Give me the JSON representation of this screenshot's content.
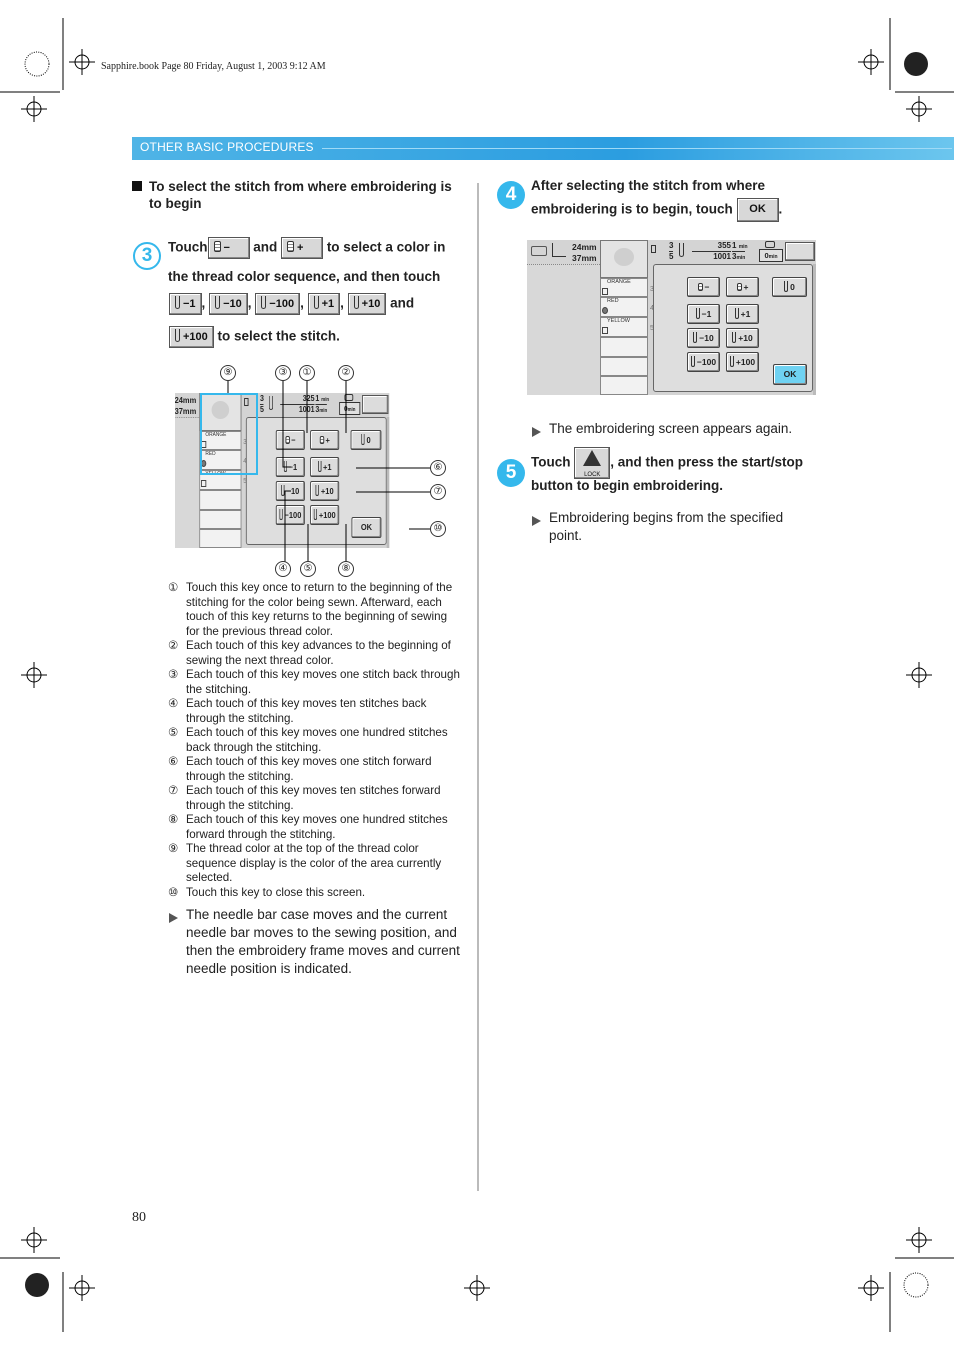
{
  "print_meta": "Sapphire.book  Page 80  Friday, August 1, 2003  9:12 AM",
  "section_header": "OTHER BASIC PROCEDURES",
  "page_number": "80",
  "left": {
    "heading": "To select the stitch from where embroidering is to begin",
    "step3": {
      "number": "3",
      "touch": "Touch",
      "and1": "and",
      "line1_end": "to select a color in",
      "line2": "the thread color sequence, and then touch",
      "and2": "and",
      "line4_end": "to select the stitch.",
      "buttons": [
        "−",
        "+",
        "−1",
        "−10",
        "−100",
        "+1",
        "+10",
        "+100"
      ],
      "comma": ","
    },
    "callouts": [
      "⑨",
      "③",
      "①",
      "②",
      "⑥",
      "⑦",
      "⑩",
      "④",
      "⑤",
      "⑧"
    ],
    "notes": [
      {
        "n": "①",
        "t": "Touch this key once to return to the beginning of the stitching for the color being sewn. Afterward, each touch of this key returns to the beginning of sewing for the previous thread color."
      },
      {
        "n": "②",
        "t": "Each touch of this key advances to the beginning of sewing the next thread color."
      },
      {
        "n": "③",
        "t": "Each touch of this key moves one stitch back through the stitching."
      },
      {
        "n": "④",
        "t": "Each touch of this key moves ten stitches back through the stitching."
      },
      {
        "n": "⑤",
        "t": "Each touch of this key moves one hundred stitches back through the stitching."
      },
      {
        "n": "⑥",
        "t": "Each touch of this key moves one stitch forward through the stitching."
      },
      {
        "n": "⑦",
        "t": "Each touch of this key moves ten stitches forward through the stitching."
      },
      {
        "n": "⑧",
        "t": "Each touch of this key moves one hundred stitches forward through the stitching."
      },
      {
        "n": "⑨",
        "t": "The thread color at the top of the thread color sequence display is the color of the area currently selected."
      },
      {
        "n": "⑩",
        "t": "Touch this key to close this screen."
      }
    ],
    "result": "The needle bar case moves and the current needle bar moves to the sewing position, and then the embroidery frame moves and current needle position is indicated."
  },
  "right": {
    "step4": {
      "number": "4",
      "line1": "After selecting the stitch from where",
      "line2": "embroidering is to begin, touch",
      "ok": "OK",
      "period": "."
    },
    "result4": "The embroidering screen appears again.",
    "step5": {
      "number": "5",
      "touch": "Touch",
      "lock": "LOCK",
      "line1_end": ", and then press the start/stop",
      "line2": "button to begin embroidering."
    },
    "result5": "Embroidering begins from the specified point."
  },
  "screens": {
    "left": {
      "width": "24mm",
      "height": "37mm",
      "colors": [
        "ORANGE",
        "RED",
        "YELLOW"
      ],
      "seq": [
        "3",
        "4",
        "5"
      ],
      "color_cur": "3",
      "color_total": "5",
      "stitch_cur": "325",
      "stitch_total": "1001",
      "time_cur": "1",
      "time_total": "3",
      "time_unit": "min",
      "time_left": "0",
      "buttons": [
        "−",
        "+",
        "0",
        "−1",
        "+1",
        "−10",
        "+10",
        "−100",
        "+100",
        "OK"
      ],
      "ok_color": "#dcdcdc"
    },
    "right": {
      "width": "24mm",
      "height": "37mm",
      "colors": [
        "ORANGE",
        "RED",
        "YELLOW"
      ],
      "seq": [
        "3",
        "4",
        "5"
      ],
      "color_cur": "3",
      "color_total": "5",
      "stitch_cur": "355",
      "stitch_total": "1001",
      "time_cur": "1",
      "time_total": "3",
      "time_unit": "min",
      "time_left": "0",
      "buttons": [
        "−",
        "+",
        "0",
        "−1",
        "+1",
        "−10",
        "+10",
        "−100",
        "+100",
        "OK"
      ],
      "ok_color": "#6fd2f2"
    }
  },
  "colors": {
    "accent": "#35b8ec",
    "header": "#2b9de0"
  }
}
